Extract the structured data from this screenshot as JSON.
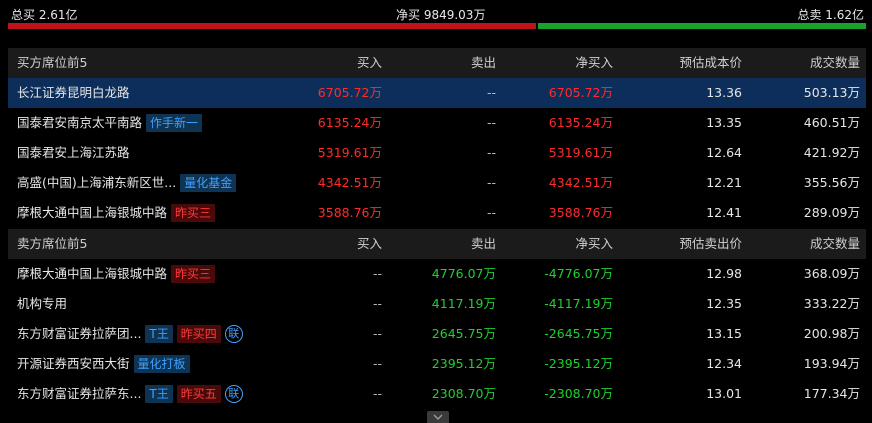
{
  "summary": {
    "total_buy": "总买 2.61亿",
    "net_buy": "净买 9849.03万",
    "total_sell": "总卖 1.62亿"
  },
  "buy_section": {
    "headers": {
      "name": "买方席位前5",
      "buy": "买入",
      "sell": "卖出",
      "net": "净买入",
      "cost": "预估成本价",
      "volume": "成交数量"
    },
    "rows": [
      {
        "name": "长江证券昆明白龙路",
        "tags": [],
        "buy": "6705.72万",
        "sell": "--",
        "net": "6705.72万",
        "cost": "13.36",
        "volume": "503.13万"
      },
      {
        "name": "国泰君安南京太平南路",
        "tags": [
          {
            "text": "作手新一",
            "kind": "blue"
          }
        ],
        "buy": "6135.24万",
        "sell": "--",
        "net": "6135.24万",
        "cost": "13.35",
        "volume": "460.51万"
      },
      {
        "name": "国泰君安上海江苏路",
        "tags": [],
        "buy": "5319.61万",
        "sell": "--",
        "net": "5319.61万",
        "cost": "12.64",
        "volume": "421.92万"
      },
      {
        "name": "高盛(中国)上海浦东新区世...",
        "tags": [
          {
            "text": "量化基金",
            "kind": "blue"
          }
        ],
        "buy": "4342.51万",
        "sell": "--",
        "net": "4342.51万",
        "cost": "12.21",
        "volume": "355.56万"
      },
      {
        "name": "摩根大通中国上海银城中路",
        "tags": [
          {
            "text": "昨买三",
            "kind": "redtag"
          }
        ],
        "buy": "3588.76万",
        "sell": "--",
        "net": "3588.76万",
        "cost": "12.41",
        "volume": "289.09万"
      }
    ]
  },
  "sell_section": {
    "headers": {
      "name": "卖方席位前5",
      "buy": "买入",
      "sell": "卖出",
      "net": "净买入",
      "cost": "预估卖出价",
      "volume": "成交数量"
    },
    "rows": [
      {
        "name": "摩根大通中国上海银城中路",
        "tags": [
          {
            "text": "昨买三",
            "kind": "redtag"
          }
        ],
        "buy": "--",
        "sell": "4776.07万",
        "net": "-4776.07万",
        "cost": "12.98",
        "volume": "368.09万"
      },
      {
        "name": "机构专用",
        "tags": [],
        "buy": "--",
        "sell": "4117.19万",
        "net": "-4117.19万",
        "cost": "12.35",
        "volume": "333.22万"
      },
      {
        "name": "东方财富证券拉萨团...",
        "tags": [
          {
            "text": "T王",
            "kind": "blue"
          },
          {
            "text": "昨买四",
            "kind": "redtag"
          },
          {
            "text": "联",
            "kind": "lian"
          }
        ],
        "buy": "--",
        "sell": "2645.75万",
        "net": "-2645.75万",
        "cost": "13.15",
        "volume": "200.98万"
      },
      {
        "name": "开源证券西安西大街",
        "tags": [
          {
            "text": "量化打板",
            "kind": "blue"
          }
        ],
        "buy": "--",
        "sell": "2395.12万",
        "net": "-2395.12万",
        "cost": "12.34",
        "volume": "193.94万"
      },
      {
        "name": "东方财富证券拉萨东...",
        "tags": [
          {
            "text": "T王",
            "kind": "blue"
          },
          {
            "text": "昨买五",
            "kind": "redtag"
          },
          {
            "text": "联",
            "kind": "lian"
          }
        ],
        "buy": "--",
        "sell": "2308.70万",
        "net": "-2308.70万",
        "cost": "13.01",
        "volume": "177.34万"
      }
    ]
  },
  "colors": {
    "buy_red": "#ff2b2b",
    "sell_green": "#1fd12f",
    "selected_row": "#0d2e5a",
    "tag_blue": "#3ea1ff"
  },
  "icons": {
    "scroll_toggle": "chevron-down-icon"
  }
}
